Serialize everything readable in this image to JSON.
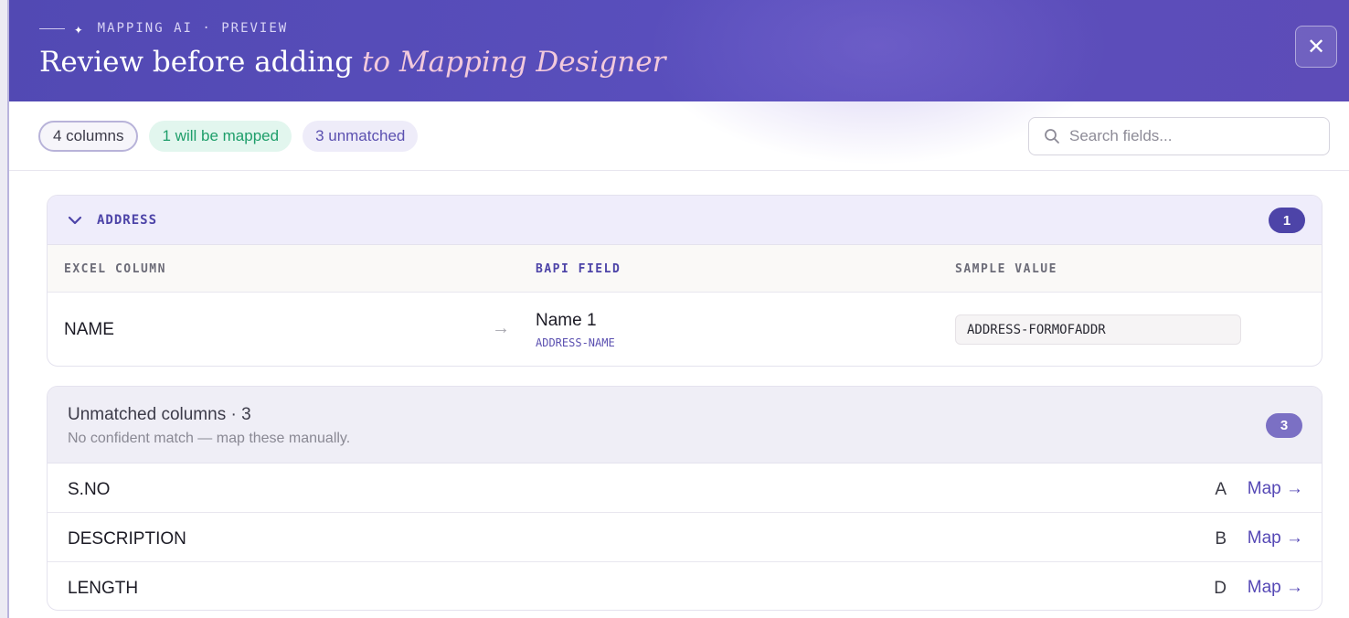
{
  "header": {
    "eyebrow": "MAPPING AI · PREVIEW",
    "title_main": "Review before adding",
    "title_emphasis": "to Mapping Designer",
    "close_glyph": "✕"
  },
  "toolbar": {
    "chips": {
      "all": "4 columns",
      "mapped": "1 will be mapped",
      "unmatched": "3 unmatched"
    },
    "search_placeholder": "Search fields..."
  },
  "group": {
    "name": "ADDRESS",
    "count": "1",
    "columns": {
      "excel": "EXCEL COLUMN",
      "bapi": "BAPI FIELD",
      "sample": "SAMPLE VALUE"
    },
    "rows": [
      {
        "excel": "NAME",
        "arrow": "→",
        "bapi_label": "Name 1",
        "bapi_code": "ADDRESS-NAME",
        "sample": "ADDRESS-FORMOFADDR"
      }
    ]
  },
  "unmatched": {
    "title": "Unmatched columns · 3",
    "subtitle": "No confident match — map these manually.",
    "count": "3",
    "map_label": "Map →",
    "rows": [
      {
        "name": "S.NO",
        "letter": "A"
      },
      {
        "name": "DESCRIPTION",
        "letter": "B"
      },
      {
        "name": "LENGTH",
        "letter": "D"
      }
    ]
  },
  "colors": {
    "header_bg": "#5249b3",
    "accent": "#4d44a8",
    "mapped_green": "#1e9e6a",
    "title_emphasis": "#f2c9dc"
  },
  "icons": [
    "sparkle-icon",
    "close-icon",
    "search-icon",
    "chevron-down-icon",
    "arrow-right-icon"
  ]
}
